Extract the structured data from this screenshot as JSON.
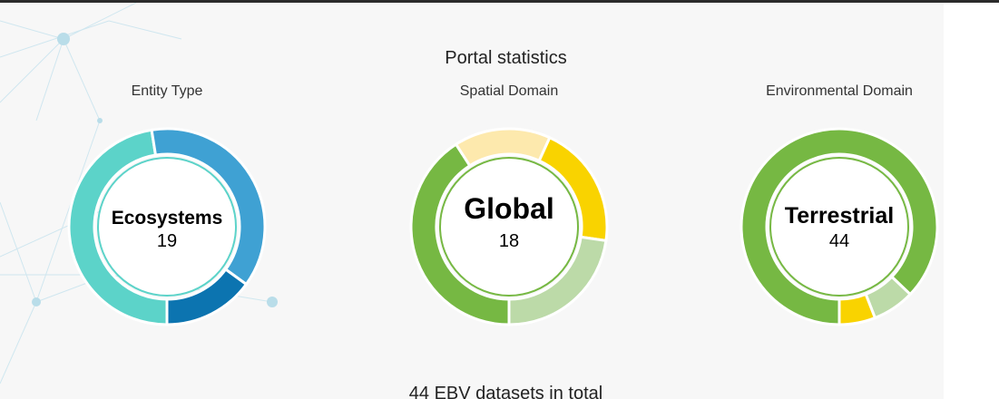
{
  "panel": {
    "title": "Portal statistics",
    "footer": "44 EBV datasets in total"
  },
  "charts": [
    {
      "label": "Entity Type",
      "center_name": "Ecosystems",
      "center_count": "19",
      "segments": [
        {
          "value": 19,
          "color": "#5cd3c9"
        },
        {
          "value": 15,
          "color": "#3fa1d3"
        },
        {
          "value": 6,
          "color": "#0c74b0"
        }
      ]
    },
    {
      "label": "Spatial Domain",
      "center_name": "Global",
      "center_count": "18",
      "segments": [
        {
          "value": 18,
          "color": "#76b843"
        },
        {
          "value": 7,
          "color": "#fde9ad"
        },
        {
          "value": 9,
          "color": "#f9d300"
        },
        {
          "value": 10,
          "color": "#bcdaa8"
        }
      ]
    },
    {
      "label": "Environmental Domain",
      "center_name": "Terrestrial",
      "center_count": "44",
      "segments": [
        {
          "value": 44,
          "color": "#76b843"
        },
        {
          "value": 3.5,
          "color": "#bcdaa8"
        },
        {
          "value": 3,
          "color": "#f9d300"
        }
      ]
    }
  ]
}
